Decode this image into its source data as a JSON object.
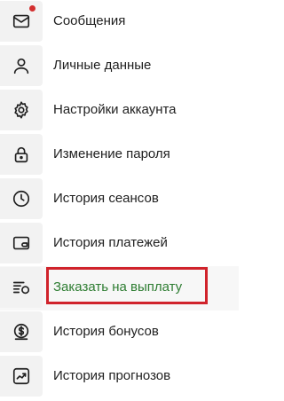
{
  "menu": {
    "items": [
      {
        "label": "Сообщения",
        "icon": "mail-icon",
        "has_badge": true
      },
      {
        "label": "Личные данные",
        "icon": "user-icon"
      },
      {
        "label": "Настройки аккаунта",
        "icon": "gear-icon"
      },
      {
        "label": "Изменение пароля",
        "icon": "lock-icon"
      },
      {
        "label": "История сеансов",
        "icon": "clock-icon"
      },
      {
        "label": "История платежей",
        "icon": "wallet-icon"
      },
      {
        "label": "Заказать на выплату",
        "icon": "payout-list-icon",
        "active": true
      },
      {
        "label": "История бонусов",
        "icon": "dollar-coin-icon"
      },
      {
        "label": "История прогнозов",
        "icon": "chart-up-icon"
      }
    ]
  },
  "colors": {
    "active_text": "#2e7d32",
    "highlight_border": "#d0232b",
    "badge": "#d32f2f",
    "icon_bg": "#f2f2f2"
  }
}
